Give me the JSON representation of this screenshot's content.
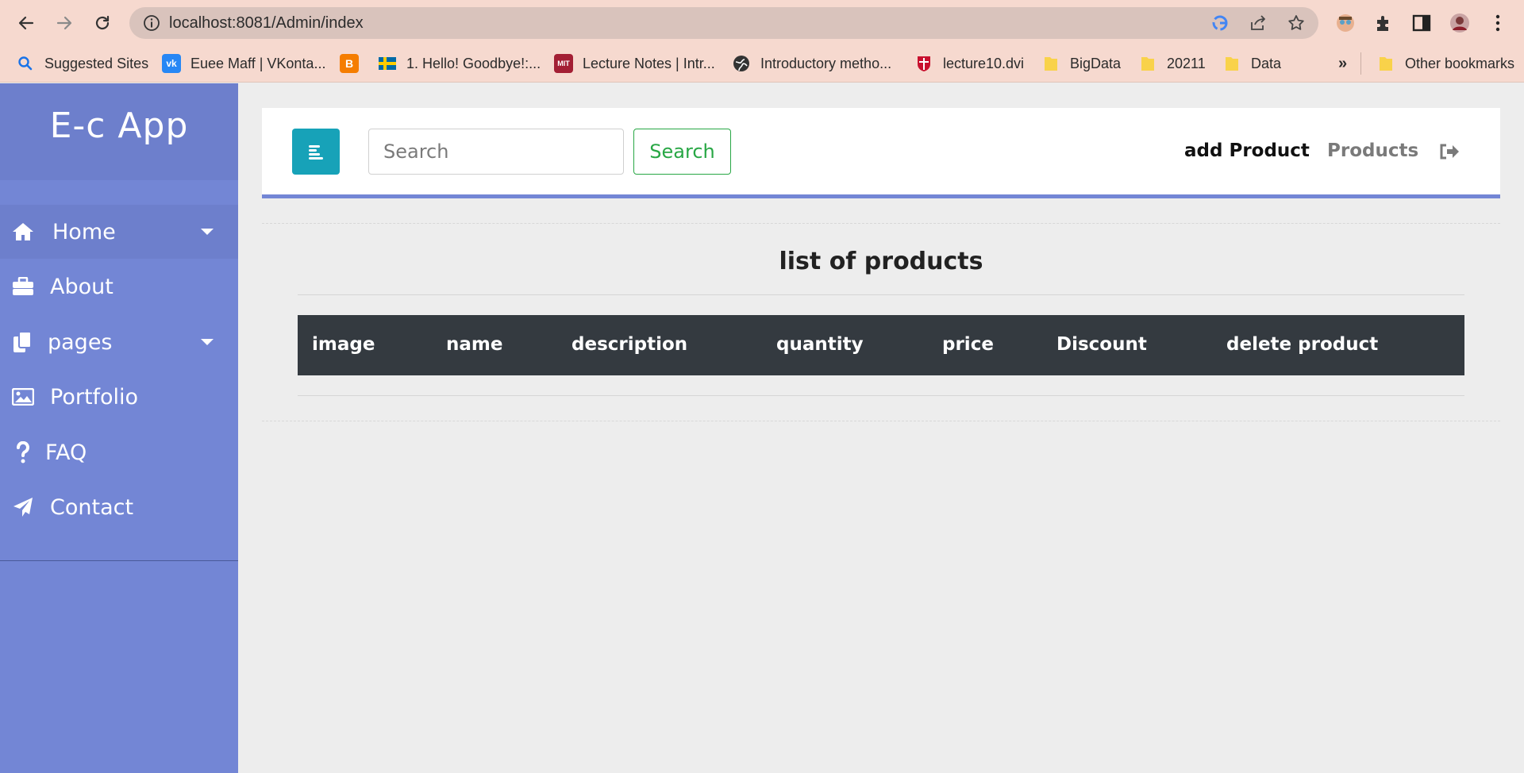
{
  "browser": {
    "url": "localhost:8081/Admin/index",
    "bookmarks": [
      {
        "label": "Suggested Sites",
        "icon": "search-icon"
      },
      {
        "label": "Euee Maff | VKonta...",
        "icon": "vk-icon"
      },
      {
        "label": "",
        "icon": "blogger-icon"
      },
      {
        "label": "1. Hello! Goodbye!:...",
        "icon": "sweden-flag-icon"
      },
      {
        "label": "Lecture Notes | Intr...",
        "icon": "mit-ocw-icon"
      },
      {
        "label": "Introductory metho...",
        "icon": "globe-icon"
      },
      {
        "label": "lecture10.dvi",
        "icon": "crest-icon"
      },
      {
        "label": "BigData",
        "icon": "folder-icon"
      },
      {
        "label": "20211",
        "icon": "folder-icon"
      },
      {
        "label": "Data",
        "icon": "folder-icon"
      }
    ],
    "more_bookmarks": "»",
    "other_bookmarks": "Other bookmarks"
  },
  "sidebar": {
    "title": "E-c App",
    "items": [
      {
        "label": "Home",
        "icon": "home-icon",
        "dropdown": true,
        "active": true
      },
      {
        "label": "About",
        "icon": "briefcase-icon",
        "dropdown": false
      },
      {
        "label": "pages",
        "icon": "copy-icon",
        "dropdown": true
      },
      {
        "label": "Portfolio",
        "icon": "image-icon",
        "dropdown": false
      },
      {
        "label": "FAQ",
        "icon": "question-icon",
        "dropdown": false
      },
      {
        "label": "Contact",
        "icon": "paper-plane-icon",
        "dropdown": false
      }
    ]
  },
  "navbar": {
    "search_placeholder": "Search",
    "search_button": "Search",
    "links": [
      "add Product",
      "Products"
    ]
  },
  "main": {
    "title": "list of products",
    "table": {
      "columns": [
        "image",
        "name",
        "description",
        "quantity",
        "price",
        "Discount",
        "delete product"
      ],
      "rows": []
    }
  },
  "colors": {
    "sidebar": "#7386d5",
    "sidebar_header": "#6d7fcc",
    "toggle_button": "#17a2b8",
    "search_button": "#28a745",
    "table_header": "#343a40",
    "chrome": "#f6d9cf"
  }
}
